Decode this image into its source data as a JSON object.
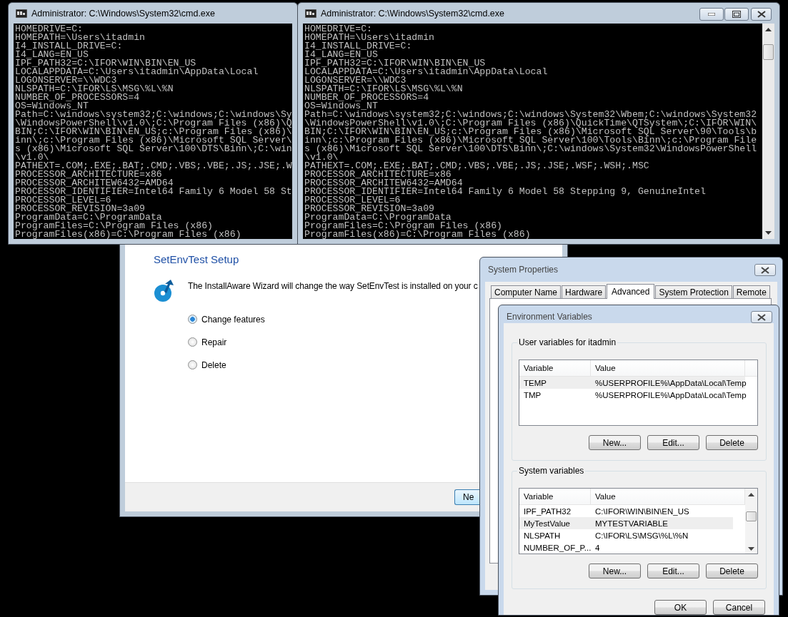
{
  "cmd_windows": [
    {
      "title": "Administrator: C:\\Windows\\System32\\cmd.exe",
      "caption_buttons": false,
      "scrollbar": false,
      "lines": [
        "HOMEDRIVE=C:",
        "HOMEPATH=\\Users\\itadmin",
        "I4_INSTALL_DRIVE=C:",
        "I4_LANG=EN_US",
        "IPF_PATH32=C:\\IFOR\\WIN\\BIN\\EN_US",
        "LOCALAPPDATA=C:\\Users\\itadmin\\AppData\\Local",
        "LOGONSERVER=\\\\WDC3",
        "NLSPATH=C:\\IFOR\\LS\\MSG\\%L\\%N",
        "NUMBER_OF_PROCESSORS=4",
        "OS=Windows_NT",
        "Path=C:\\windows\\system32;C:\\windows;C:\\windows\\Sy",
        "\\WindowsPowerShell\\v1.0\\;C:\\Program Files (x86)\\Q",
        "BIN;C:\\IFOR\\WIN\\BIN\\EN_US;c:\\Program Files (x86)\\",
        "inn\\;c:\\Program Files (x86)\\Microsoft SQL Server\\",
        "s (x86)\\Microsoft SQL Server\\100\\DTS\\Binn\\;C:\\win",
        "\\v1.0\\",
        "PATHEXT=.COM;.EXE;.BAT;.CMD;.VBS;.VBE;.JS;.JSE;.W",
        "PROCESSOR_ARCHITECTURE=x86",
        "PROCESSOR_ARCHITEW6432=AMD64",
        "PROCESSOR_IDENTIFIER=Intel64 Family 6 Model 58 St",
        "PROCESSOR_LEVEL=6",
        "PROCESSOR_REVISION=3a09",
        "ProgramData=C:\\ProgramData",
        "ProgramFiles=C:\\Program Files (x86)",
        "ProgramFiles(x86)=C:\\Program Files (x86)"
      ]
    },
    {
      "title": "Administrator: C:\\Windows\\System32\\cmd.exe",
      "caption_buttons": true,
      "scrollbar": true,
      "lines": [
        "HOMEDRIVE=C:",
        "HOMEPATH=\\Users\\itadmin",
        "I4_INSTALL_DRIVE=C:",
        "I4_LANG=EN_US",
        "IPF_PATH32=C:\\IFOR\\WIN\\BIN\\EN_US",
        "LOCALAPPDATA=C:\\Users\\itadmin\\AppData\\Local",
        "LOGONSERVER=\\\\WDC3",
        "NLSPATH=C:\\IFOR\\LS\\MSG\\%L\\%N",
        "NUMBER_OF_PROCESSORS=4",
        "OS=Windows_NT",
        "Path=C:\\windows\\system32;C:\\windows;C:\\windows\\System32\\Wbem;C:\\windows\\System32",
        "\\WindowsPowerShell\\v1.0\\;C:\\Program Files (x86)\\QuickTime\\QTSystem\\;C:\\IFOR\\WIN\\",
        "BIN;C:\\IFOR\\WIN\\BIN\\EN_US;c:\\Program Files (x86)\\Microsoft SQL Server\\90\\Tools\\b",
        "inn\\;c:\\Program Files (x86)\\Microsoft SQL Server\\100\\Tools\\Binn\\;c:\\Program File",
        "s (x86)\\Microsoft SQL Server\\100\\DTS\\Binn\\;C:\\windows\\System32\\WindowsPowerShell",
        "\\v1.0\\",
        "PATHEXT=.COM;.EXE;.BAT;.CMD;.VBS;.VBE;.JS;.JSE;.WSF;.WSH;.MSC",
        "PROCESSOR_ARCHITECTURE=x86",
        "PROCESSOR_ARCHITEW6432=AMD64",
        "PROCESSOR_IDENTIFIER=Intel64 Family 6 Model 58 Stepping 9, GenuineIntel",
        "PROCESSOR_LEVEL=6",
        "PROCESSOR_REVISION=3a09",
        "ProgramData=C:\\ProgramData",
        "ProgramFiles=C:\\Program Files (x86)",
        "ProgramFiles(x86)=C:\\Program Files (x86)"
      ]
    }
  ],
  "setup": {
    "title": "SetEnvTest Setup",
    "description": "The InstallAware Wizard will change the way SetEnvTest is installed on your c",
    "options": [
      {
        "label": "Change features",
        "selected": true
      },
      {
        "label": "Repair",
        "selected": false
      },
      {
        "label": "Delete",
        "selected": false
      }
    ],
    "buttons": [
      "Ne"
    ]
  },
  "system_properties": {
    "title": "System Properties",
    "tabs": [
      {
        "label": "Computer Name",
        "selected": false
      },
      {
        "label": "Hardware",
        "selected": false
      },
      {
        "label": "Advanced",
        "selected": true
      },
      {
        "label": "System Protection",
        "selected": false
      },
      {
        "label": "Remote",
        "selected": false
      }
    ]
  },
  "environment_variables": {
    "title": "Environment Variables",
    "groups": [
      {
        "title": "User variables for itadmin",
        "columns": [
          "Variable",
          "Value"
        ],
        "scrollbar": false,
        "rows": [
          {
            "variable": "TEMP",
            "value": "%USERPROFILE%\\AppData\\Local\\Temp",
            "selected": true
          },
          {
            "variable": "TMP",
            "value": "%USERPROFILE%\\AppData\\Local\\Temp",
            "selected": false
          }
        ],
        "buttons": [
          "New...",
          "Edit...",
          "Delete"
        ]
      },
      {
        "title": "System variables",
        "columns": [
          "Variable",
          "Value"
        ],
        "scrollbar": true,
        "rows": [
          {
            "variable": "IPF_PATH32",
            "value": "C:\\IFOR\\WIN\\BIN\\EN_US",
            "selected": false
          },
          {
            "variable": "MyTestValue",
            "value": "MYTESTVARIABLE",
            "selected": true
          },
          {
            "variable": "NLSPATH",
            "value": "C:\\IFOR\\LS\\MSG\\%L\\%N",
            "selected": false
          },
          {
            "variable": "NUMBER_OF_P...",
            "value": "4",
            "selected": false
          }
        ],
        "buttons": [
          "New...",
          "Edit...",
          "Delete"
        ]
      }
    ],
    "buttons": [
      "OK",
      "Cancel"
    ]
  }
}
